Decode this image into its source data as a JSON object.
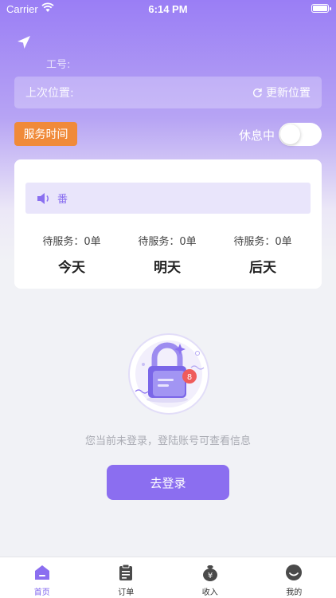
{
  "status_bar": {
    "carrier": "Carrier",
    "time": "6:14 PM"
  },
  "header": {
    "job_number_label": "工号:",
    "last_location_label": "上次位置:",
    "refresh_location_label": "更新位置",
    "service_time_label": "服务时间",
    "rest_label": "休息中",
    "rest_toggle_on": false
  },
  "card": {
    "notice_text": "番",
    "days": [
      {
        "pending": "待服务：0单",
        "name": "今天"
      },
      {
        "pending": "待服务：0单",
        "name": "明天"
      },
      {
        "pending": "待服务：0单",
        "name": "后天"
      }
    ]
  },
  "login": {
    "hint": "您当前未登录，登陆账号可查看信息",
    "button_label": "去登录"
  },
  "tabbar": {
    "items": [
      {
        "label": "首页",
        "icon": "home-icon",
        "active": true
      },
      {
        "label": "订单",
        "icon": "order-icon",
        "active": false
      },
      {
        "label": "收入",
        "icon": "income-icon",
        "active": false
      },
      {
        "label": "我的",
        "icon": "profile-icon",
        "active": false
      }
    ]
  },
  "colors": {
    "accent": "#8b6ef0",
    "orange": "#f08a39",
    "background": "#f1f2f6"
  }
}
